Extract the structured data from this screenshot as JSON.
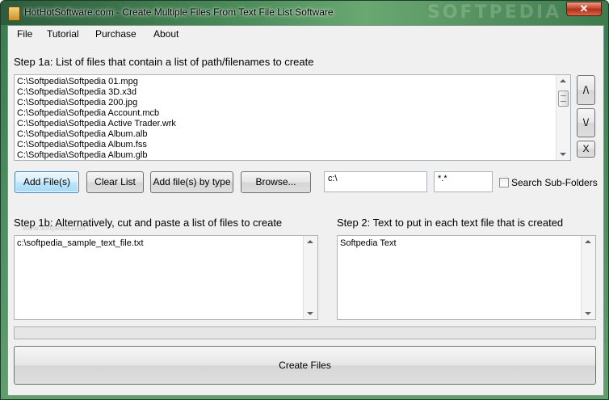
{
  "window": {
    "title": "HotHotSoftware.com - Create Multiple Files From Text File List Software",
    "watermark": "SOFTPEDIA",
    "close_glyph": "✕"
  },
  "menu": [
    "File",
    "Tutorial",
    "Purchase",
    "About"
  ],
  "step1a": {
    "label": "Step 1a: List of files that contain a list of path/filenames to create",
    "files": [
      "C:\\Softpedia\\Softpedia 01.mpg",
      "C:\\Softpedia\\Softpedia 3D.x3d",
      "C:\\Softpedia\\Softpedia 200.jpg",
      "C:\\Softpedia\\Softpedia Account.mcb",
      "C:\\Softpedia\\Softpedia Active Trader.wrk",
      "C:\\Softpedia\\Softpedia Album.alb",
      "C:\\Softpedia\\Softpedia Album.fss",
      "C:\\Softpedia\\Softpedia Album.glb"
    ],
    "move_up": "/\\",
    "move_down": "\\/",
    "remove": "X"
  },
  "toolbar": {
    "add_files": "Add File(s)",
    "clear_list": "Clear List",
    "add_by_type": "Add file(s) by type",
    "browse": "Browse...",
    "path_value": "c:\\",
    "filter_value": "*.*",
    "search_subfolders": "Search Sub-Folders",
    "softpedia_watermark": "www.softpedia.com"
  },
  "step1b": {
    "label": "Step 1b: Alternatively, cut and paste a list of files to create",
    "content": "c:\\softpedia_sample_text_file.txt"
  },
  "step2": {
    "label": "Step 2: Text to put in each text file that is created",
    "content": "Softpedia Text"
  },
  "progress": {
    "value": 0
  },
  "create_button": "Create Files"
}
